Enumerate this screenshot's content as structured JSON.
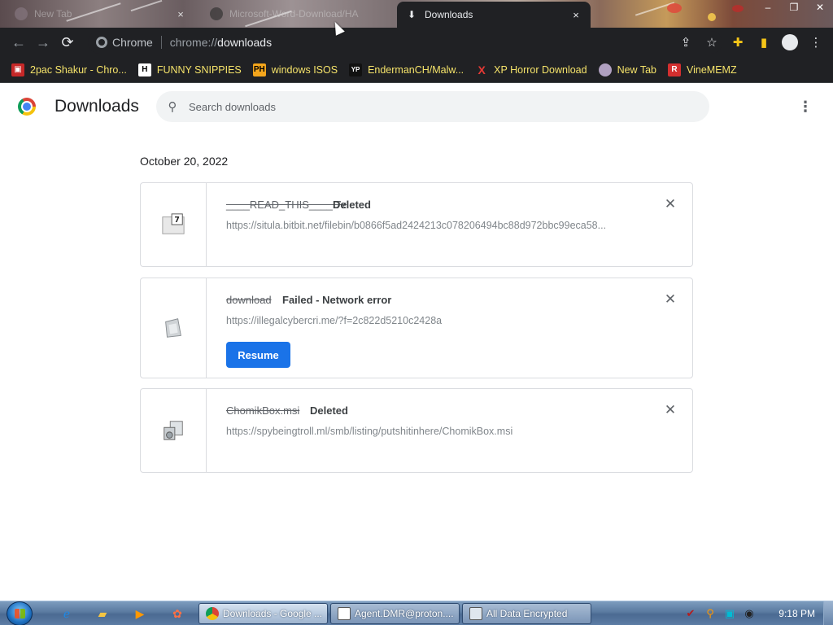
{
  "browser": {
    "tabs": [
      {
        "title": "New Tab",
        "active": false
      },
      {
        "title": "Microsoft-Word-Download/HA",
        "active": false
      },
      {
        "title": "Downloads",
        "active": true
      }
    ],
    "close_glyph": "×",
    "window_controls": [
      "–",
      "❐",
      "✕"
    ],
    "omnibox": {
      "site_chip": "Chrome",
      "url_scheme": "chrome://",
      "url_host": "downloads"
    },
    "bookmarks": [
      {
        "label": "2pac Shakur - Chro...",
        "icon": "bookmark-icon",
        "icon_color": "#ffffff"
      },
      {
        "label": "FUNNY SNIPPIES",
        "icon": "H",
        "icon_color": "#ffffff"
      },
      {
        "label": "windows ISOS",
        "icon": "PH",
        "icon_color": "#f4a61c"
      },
      {
        "label": "EndermanCH/Malw...",
        "icon": "YP",
        "icon_color": "#ffffff"
      },
      {
        "label": "XP Horror Download",
        "icon": "X",
        "icon_color": "#e53935"
      },
      {
        "label": "New Tab",
        "icon": "globe-icon",
        "icon_color": "#b0a0c0"
      },
      {
        "label": "VineMEMZ",
        "icon": "R",
        "icon_color": "#d32f2f"
      }
    ]
  },
  "page": {
    "title": "Downloads",
    "search_placeholder": "Search downloads",
    "date_header": "October 20, 2022",
    "downloads": [
      {
        "file_name": "____READ_THIS____.7z",
        "status": "Deleted",
        "url": "https://situla.bitbit.net/filebin/b0866f5ad2424213c078206494bc88d972bbc99eca58...",
        "icon": "archive-file-icon",
        "action": null
      },
      {
        "file_name": "download",
        "status": "Failed - Network error",
        "url": "https://illegalcybercri.me/?f=2c822d5210c2428a",
        "icon": "generic-file-icon",
        "action": "Resume"
      },
      {
        "file_name": "ChomikBox.msi",
        "status": "Deleted",
        "url": "https://spybeingtroll.ml/smb/listing/putshitinhere/ChomikBox.msi",
        "icon": "installer-file-icon",
        "action": null
      }
    ]
  },
  "taskbar": {
    "buttons": [
      {
        "label": "Downloads - Google ...",
        "active": true
      },
      {
        "label": "Agent.DMR@proton....",
        "active": false
      },
      {
        "label": "All Data Encrypted",
        "active": false
      }
    ],
    "clock": "9:18 PM"
  },
  "colors": {
    "accent": "#1a73e8",
    "toolbar_bg": "#202124",
    "bookmark_text": "#f5e36a"
  }
}
